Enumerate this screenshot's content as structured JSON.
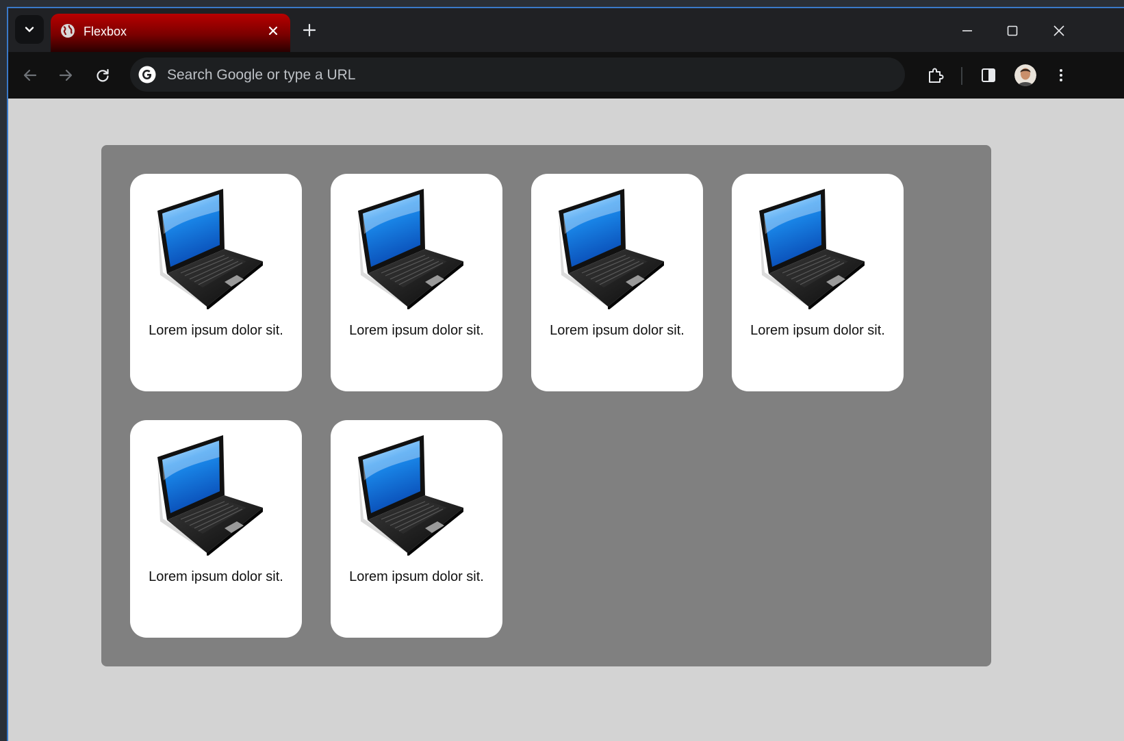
{
  "browser": {
    "tab": {
      "title": "Flexbox",
      "favicon": "globe-icon"
    },
    "omnibox": {
      "placeholder": "Search Google or type a URL",
      "value": ""
    },
    "colors": {
      "tab_gradient_top": "#b80000",
      "titlebar": "#202124",
      "toolbar": "#111111"
    }
  },
  "page": {
    "colors": {
      "background": "#d3d3d3",
      "container": "#808080",
      "card": "#ffffff"
    },
    "cards": [
      {
        "image": "laptop-image",
        "text": "Lorem ipsum dolor sit."
      },
      {
        "image": "laptop-image",
        "text": "Lorem ipsum dolor sit."
      },
      {
        "image": "laptop-image",
        "text": "Lorem ipsum dolor sit."
      },
      {
        "image": "laptop-image",
        "text": "Lorem ipsum dolor sit."
      },
      {
        "image": "laptop-image",
        "text": "Lorem ipsum dolor sit."
      },
      {
        "image": "laptop-image",
        "text": "Lorem ipsum dolor sit."
      }
    ]
  }
}
